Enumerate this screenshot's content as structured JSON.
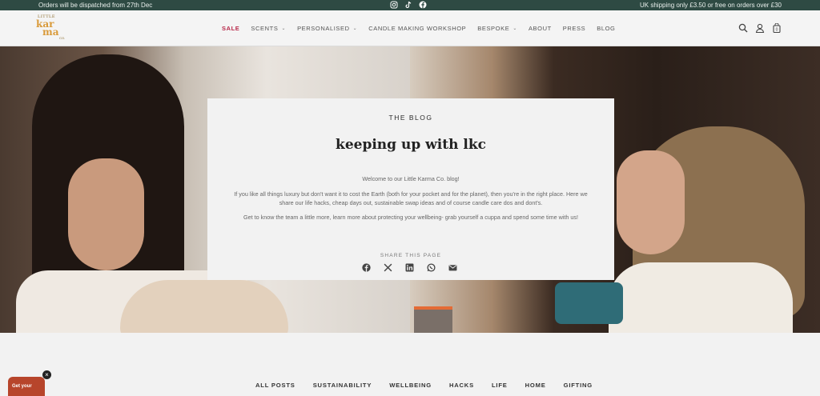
{
  "announcement": {
    "left": "Orders will be dispatched from 27th Dec",
    "right": "UK shipping only £3.50 or free on orders over £30",
    "social_icons": [
      "instagram-icon",
      "tiktok-icon",
      "facebook-icon"
    ]
  },
  "logo": {
    "small": "LITTLE",
    "line1": "kar",
    "line2": "ma",
    "line3": "CO."
  },
  "nav": {
    "items": [
      {
        "label": "SALE",
        "dropdown": false
      },
      {
        "label": "SCENTS",
        "dropdown": true
      },
      {
        "label": "PERSONALISED",
        "dropdown": true
      },
      {
        "label": "CANDLE MAKING WORKSHOP",
        "dropdown": false
      },
      {
        "label": "BESPOKE",
        "dropdown": true
      },
      {
        "label": "ABOUT",
        "dropdown": false
      },
      {
        "label": "PRESS",
        "dropdown": false
      },
      {
        "label": "BLOG",
        "dropdown": false
      }
    ],
    "icons": [
      "search-icon",
      "account-icon",
      "cart-icon"
    ],
    "cart_count": "0"
  },
  "blog_card": {
    "eyebrow": "THE BLOG",
    "title": "keeping up with lkc",
    "p1": "Welcome to our Little Karma Co. blog!",
    "p2": "If you like all things luxury but don't want it to cost the Earth (both for your pocket and for the planet), then you're in the right place. Here we share our life hacks, cheap days out, sustainable swap ideas and of course candle care dos and dont's.",
    "p3": "Get to know the team a little more, learn more about protecting your wellbeing- grab yourself a cuppa and spend some time with us!",
    "share_label": "SHARE THIS PAGE",
    "share_icons": [
      "facebook-icon",
      "x-icon",
      "linkedin-icon",
      "whatsapp-icon",
      "email-icon"
    ]
  },
  "categories": [
    "ALL POSTS",
    "SUSTAINABILITY",
    "WELLBEING",
    "HACKS",
    "LIFE",
    "HOME",
    "GIFTING"
  ],
  "promo": {
    "label": "Get your",
    "close": "×"
  },
  "colors": {
    "announce_bg": "#2e4a43",
    "sale": "#b8294a",
    "logo": "#d99a3a",
    "promo": "#b7452b"
  }
}
